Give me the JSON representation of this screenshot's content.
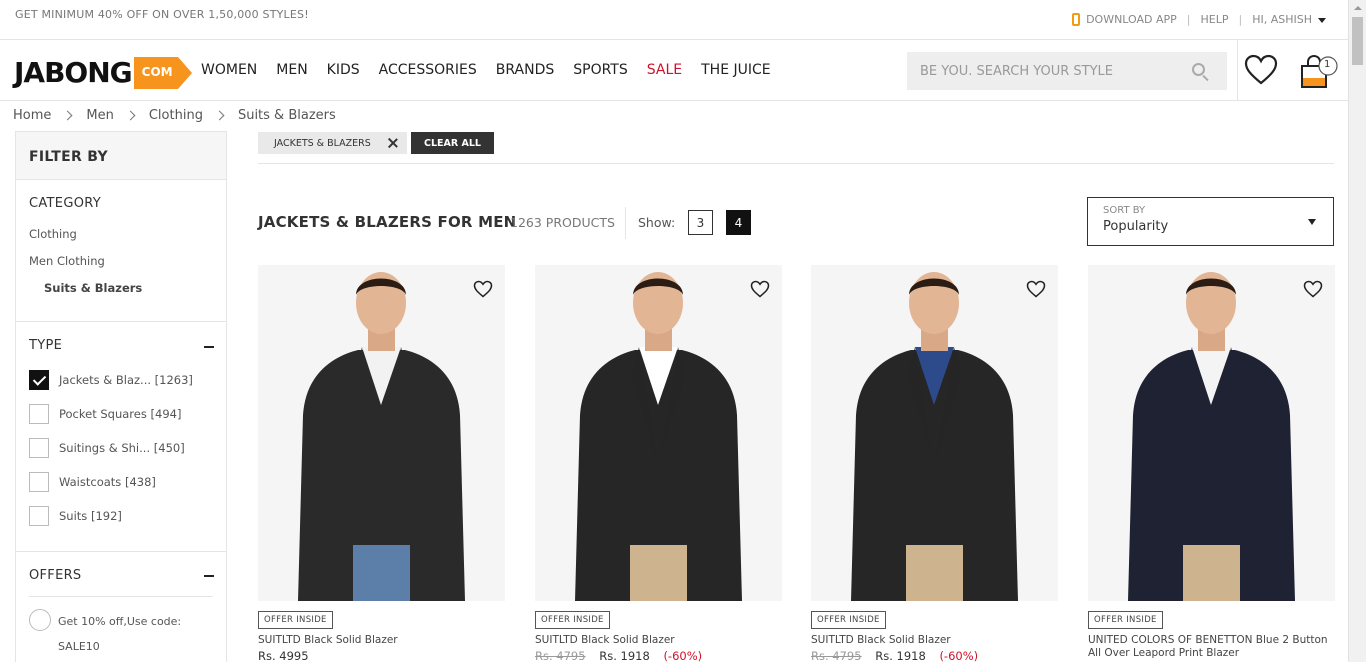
{
  "topbar": {
    "promo": "GET MINIMUM 40% OFF ON OVER 1,50,000 STYLES!",
    "download_app": "DOWNLOAD APP",
    "help": "HELP",
    "user": "HI, ASHISH"
  },
  "header": {
    "logo_text": "JABONG",
    "logo_com": "COM",
    "nav": [
      "WOMEN",
      "MEN",
      "KIDS",
      "ACCESSORIES",
      "BRANDS",
      "SPORTS",
      "SALE",
      "THE JUICE"
    ],
    "search_placeholder": "BE YOU. SEARCH YOUR STYLE",
    "bag_count": "1",
    "sale_color": "#d0112b",
    "accent": "#f7941d"
  },
  "breadcrumb": [
    "Home",
    "Men",
    "Clothing",
    "Suits & Blazers"
  ],
  "filters": {
    "title": "FILTER BY",
    "category_title": "CATEGORY",
    "categories": [
      "Clothing",
      "Men Clothing",
      "Suits & Blazers"
    ],
    "type_title": "TYPE",
    "types": [
      {
        "label": "Jackets & Blaz...",
        "count": "[1263]",
        "checked": true
      },
      {
        "label": "Pocket Squares",
        "count": "[494]",
        "checked": false
      },
      {
        "label": "Suitings & Shi...",
        "count": "[450]",
        "checked": false
      },
      {
        "label": "Waistcoats",
        "count": "[438]",
        "checked": false
      },
      {
        "label": "Suits",
        "count": "[192]",
        "checked": false
      }
    ],
    "offers_title": "OFFERS",
    "offer_line1": "Get 10% off,Use code:",
    "offer_line2": "SALE10"
  },
  "applied": {
    "chip": "JACKETS & BLAZERS",
    "clear_all": "CLEAR ALL"
  },
  "listing": {
    "title": "JACKETS & BLAZERS FOR MEN",
    "count": "1263 PRODUCTS",
    "show_label": "Show:",
    "col3": "3",
    "col4": "4",
    "sort_label": "SORT BY",
    "sort_value": "Popularity"
  },
  "products": [
    {
      "badge": "OFFER INSIDE",
      "name": "SUITLTD Black Solid Blazer",
      "name2": "",
      "old_price": "",
      "price": "Rs. 4995",
      "off": "",
      "jacket": "#2a2a2a",
      "shirt": "#f2f2f2"
    },
    {
      "badge": "OFFER INSIDE",
      "name": "SUITLTD Black Solid Blazer",
      "name2": "",
      "old_price": "Rs. 4795",
      "price": "Rs. 1918",
      "off": "(-60%)",
      "jacket": "#262626",
      "shirt": "#ffffff"
    },
    {
      "badge": "OFFER INSIDE",
      "name": "SUITLTD Black Solid Blazer",
      "name2": "",
      "old_price": "Rs. 4795",
      "price": "Rs. 1918",
      "off": "(-60%)",
      "jacket": "#262626",
      "shirt": "#2d4a8a"
    },
    {
      "badge": "OFFER INSIDE",
      "name": "UNITED COLORS OF BENETTON Blue 2 Button",
      "name2": "All Over Leapord Print Blazer",
      "old_price": "",
      "price": "",
      "off": "",
      "jacket": "#1e2233",
      "shirt": "#f4f4f4"
    }
  ]
}
